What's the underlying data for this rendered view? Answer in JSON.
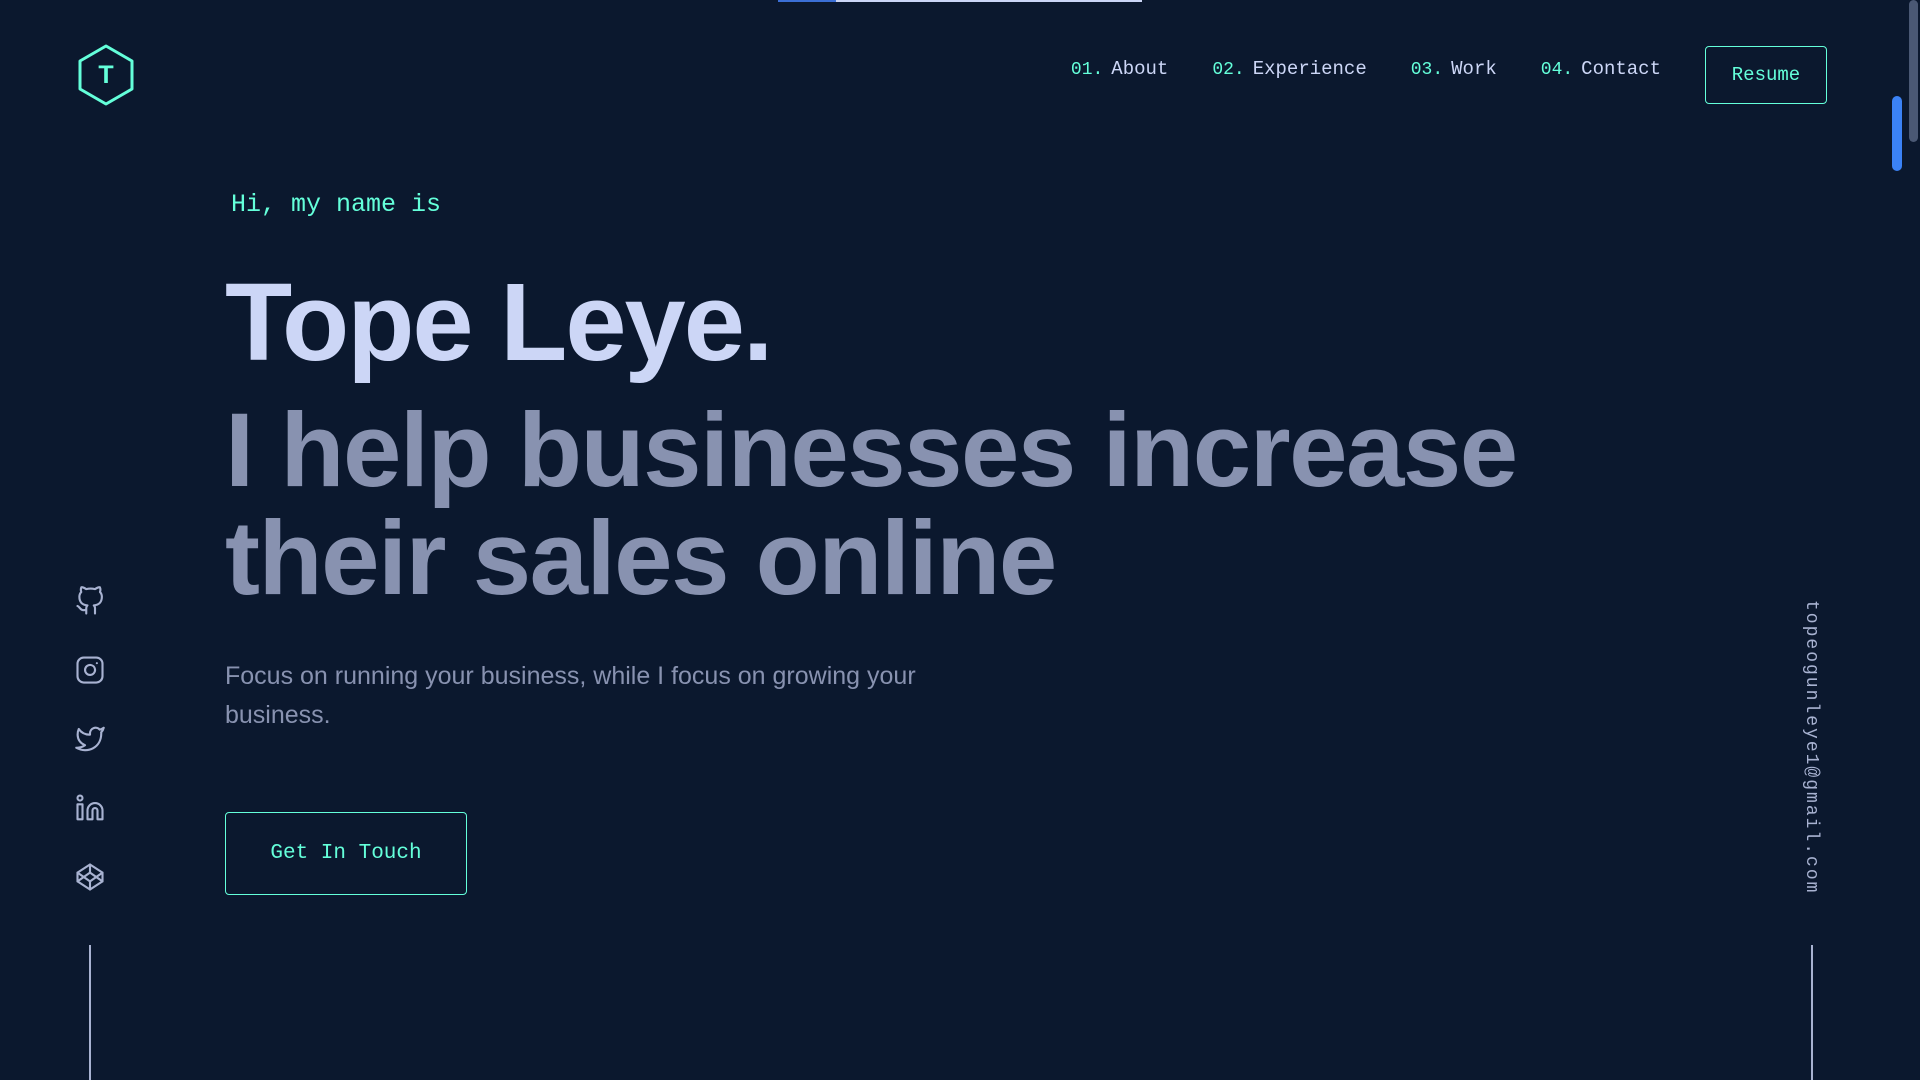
{
  "colors": {
    "background": "#0b182e",
    "accent": "#64ffda",
    "heading": "#ccd6f6",
    "muted": "#8892b0",
    "scroll_blue": "#3b82f6"
  },
  "logo": {
    "letter": "T",
    "icon": "hexagon-logo-icon"
  },
  "nav": {
    "items": [
      {
        "num": "01.",
        "label": "About"
      },
      {
        "num": "02.",
        "label": "Experience"
      },
      {
        "num": "03.",
        "label": "Work"
      },
      {
        "num": "04.",
        "label": "Contact"
      }
    ],
    "resume_label": "Resume"
  },
  "hero": {
    "greeting": "Hi, my name is",
    "name": "Tope Leye.",
    "tagline": "I help businesses increase their sales online",
    "description": "Focus on running your business, while I focus on growing your business.",
    "cta_label": "Get In Touch"
  },
  "socials": [
    {
      "name": "github",
      "icon": "github-icon"
    },
    {
      "name": "instagram",
      "icon": "instagram-icon"
    },
    {
      "name": "twitter",
      "icon": "twitter-icon"
    },
    {
      "name": "linkedin",
      "icon": "linkedin-icon"
    },
    {
      "name": "codepen",
      "icon": "codepen-icon"
    }
  ],
  "email": "topeogunleye1@gmail.com",
  "scroll_progress": 0.16
}
